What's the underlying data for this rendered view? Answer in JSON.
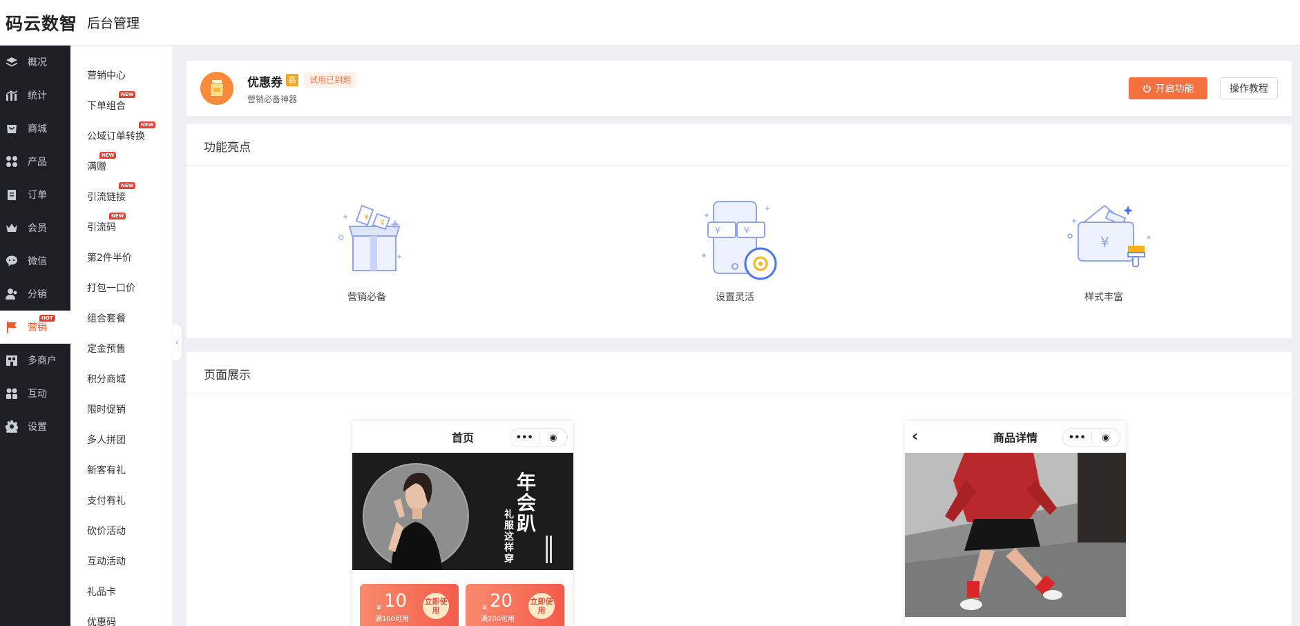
{
  "header": {
    "brand": "码云数智",
    "subtitle": "后台管理"
  },
  "sidebar": {
    "items": [
      {
        "label": "概况",
        "icon": "layers-icon"
      },
      {
        "label": "统计",
        "icon": "chart-icon"
      },
      {
        "label": "商城",
        "icon": "mall-icon"
      },
      {
        "label": "产品",
        "icon": "grid-icon"
      },
      {
        "label": "订单",
        "icon": "order-icon"
      },
      {
        "label": "会员",
        "icon": "crown-icon"
      },
      {
        "label": "微信",
        "icon": "wechat-icon"
      },
      {
        "label": "分销",
        "icon": "users-icon"
      },
      {
        "label": "营销",
        "icon": "flag-icon",
        "badge": "HOT",
        "active": true
      },
      {
        "label": "多商户",
        "icon": "store-icon"
      },
      {
        "label": "互动",
        "icon": "group-icon"
      },
      {
        "label": "设置",
        "icon": "gear-icon"
      }
    ]
  },
  "submenu": {
    "items": [
      {
        "label": "营销中心"
      },
      {
        "label": "下单组合",
        "badge": "NEW"
      },
      {
        "label": "公域订单转换",
        "badge": "NEW"
      },
      {
        "label": "满赠",
        "badge": "NEW"
      },
      {
        "label": "引流链接",
        "badge": "NEW"
      },
      {
        "label": "引流码",
        "badge": "NEW"
      },
      {
        "label": "第2件半价"
      },
      {
        "label": "打包一口价"
      },
      {
        "label": "组合套餐"
      },
      {
        "label": "定金预售"
      },
      {
        "label": "积分商城"
      },
      {
        "label": "限时促销"
      },
      {
        "label": "多人拼团"
      },
      {
        "label": "新客有礼"
      },
      {
        "label": "支付有礼"
      },
      {
        "label": "砍价活动"
      },
      {
        "label": "互动活动"
      },
      {
        "label": "礼品卡"
      },
      {
        "label": "优惠码"
      }
    ],
    "collapse_glyph": "‹"
  },
  "plugin": {
    "name": "优惠券",
    "grade": "高",
    "status": "试用已到期",
    "description": "营销必备神器",
    "enable_label": "开启功能",
    "tutorial_label": "操作教程",
    "accent": "#f5703f"
  },
  "features": {
    "title": "功能亮点",
    "items": [
      {
        "label": "营销必备",
        "icon": "gift-box-icon"
      },
      {
        "label": "设置灵活",
        "icon": "phone-settings-icon"
      },
      {
        "label": "样式丰富",
        "icon": "wallet-coupon-icon"
      }
    ]
  },
  "showcase": {
    "title": "页面展示",
    "home_phone": {
      "title": "首页",
      "capsule_more": "•••",
      "capsule_target": "◉",
      "banner_title": "年会趴",
      "banner_sub": "礼服这样穿",
      "coupons": [
        {
          "currency": "¥",
          "amount": "10",
          "condition": "满100可用",
          "action": "立即使用"
        },
        {
          "currency": "¥",
          "amount": "20",
          "condition": "满200可用",
          "action": "立即使用"
        }
      ]
    },
    "detail_phone": {
      "title": "商品详情",
      "back": "‹",
      "capsule_more": "•••",
      "capsule_target": "◉"
    }
  }
}
